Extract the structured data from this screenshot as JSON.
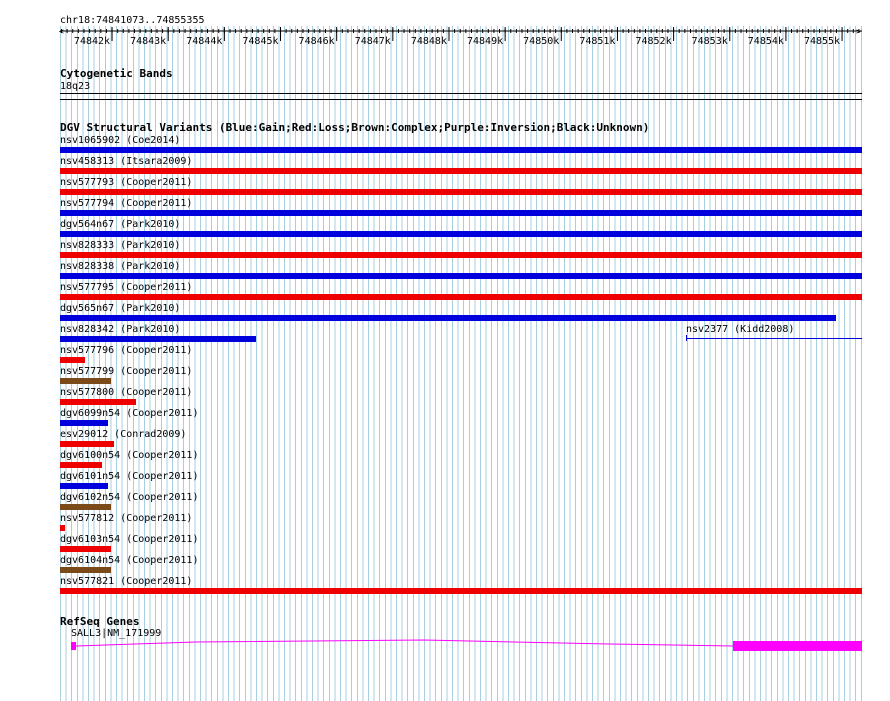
{
  "locus": "chr18:74841073..74855355",
  "ruler": {
    "start_kb": 74841.073,
    "end_kb": 74855.355,
    "tick_labels": [
      "74842k",
      "74843k",
      "74844k",
      "74845k",
      "74846k",
      "74847k",
      "74848k",
      "74849k",
      "74850k",
      "74851k",
      "74852k",
      "74853k",
      "74854k",
      "74855k"
    ]
  },
  "cytoband": {
    "title": "Cytogenetic Bands",
    "band": "18q23"
  },
  "dgv": {
    "title": "DGV Structural Variants (Blue:Gain;Red:Loss;Brown:Complex;Purple:Inversion;Black:Unknown)",
    "colors": {
      "gain": "#0000dd",
      "loss": "#ee0000",
      "complex": "#7a4a1a"
    },
    "variants": [
      {
        "label": "nsv1065902 (Coe2014)",
        "type": "gain",
        "end_frac": 1.0
      },
      {
        "label": "nsv458313 (Itsara2009)",
        "type": "loss",
        "end_frac": 1.0
      },
      {
        "label": "nsv577793 (Cooper2011)",
        "type": "loss",
        "end_frac": 1.0
      },
      {
        "label": "nsv577794 (Cooper2011)",
        "type": "gain",
        "end_frac": 1.0
      },
      {
        "label": "dgv564n67 (Park2010)",
        "type": "gain",
        "end_frac": 1.0
      },
      {
        "label": "nsv828333 (Park2010)",
        "type": "loss",
        "end_frac": 1.0
      },
      {
        "label": "nsv828338 (Park2010)",
        "type": "gain",
        "end_frac": 1.0
      },
      {
        "label": "nsv577795 (Cooper2011)",
        "type": "loss",
        "end_frac": 1.0
      },
      {
        "label": "dgv565n67 (Park2010)",
        "type": "gain",
        "end_frac": 0.968
      },
      {
        "label": "nsv828342 (Park2010)",
        "type": "gain",
        "end_frac": 0.244
      },
      {
        "label": "nsv577796 (Cooper2011)",
        "type": "loss",
        "end_frac": 0.031
      },
      {
        "label": "nsv577799 (Cooper2011)",
        "type": "complex",
        "end_frac": 0.064
      },
      {
        "label": "nsv577800 (Cooper2011)",
        "type": "loss",
        "end_frac": 0.095
      },
      {
        "label": "dgv6099n54 (Cooper2011)",
        "type": "gain",
        "end_frac": 0.06
      },
      {
        "label": "esv29012 (Conrad2009)",
        "type": "loss",
        "end_frac": 0.067
      },
      {
        "label": "dgv6100n54 (Cooper2011)",
        "type": "loss",
        "end_frac": 0.052
      },
      {
        "label": "dgv6101n54 (Cooper2011)",
        "type": "gain",
        "end_frac": 0.06
      },
      {
        "label": "dgv6102n54 (Cooper2011)",
        "type": "complex",
        "end_frac": 0.064
      },
      {
        "label": "nsv577812 (Cooper2011)",
        "type": "loss",
        "end_frac": 0.006
      },
      {
        "label": "dgv6103n54 (Cooper2011)",
        "type": "loss",
        "end_frac": 0.064
      },
      {
        "label": "dgv6104n54 (Cooper2011)",
        "type": "complex",
        "end_frac": 0.064
      },
      {
        "label": "nsv577821 (Cooper2011)",
        "type": "loss",
        "end_frac": 1.0
      }
    ],
    "extra": {
      "label": "nsv2377 (Kidd2008)",
      "color": "#0000dd"
    }
  },
  "refseq": {
    "title": "RefSeq Genes",
    "gene_label": "SALL3|NM_171999",
    "color": "#ff00ff"
  }
}
